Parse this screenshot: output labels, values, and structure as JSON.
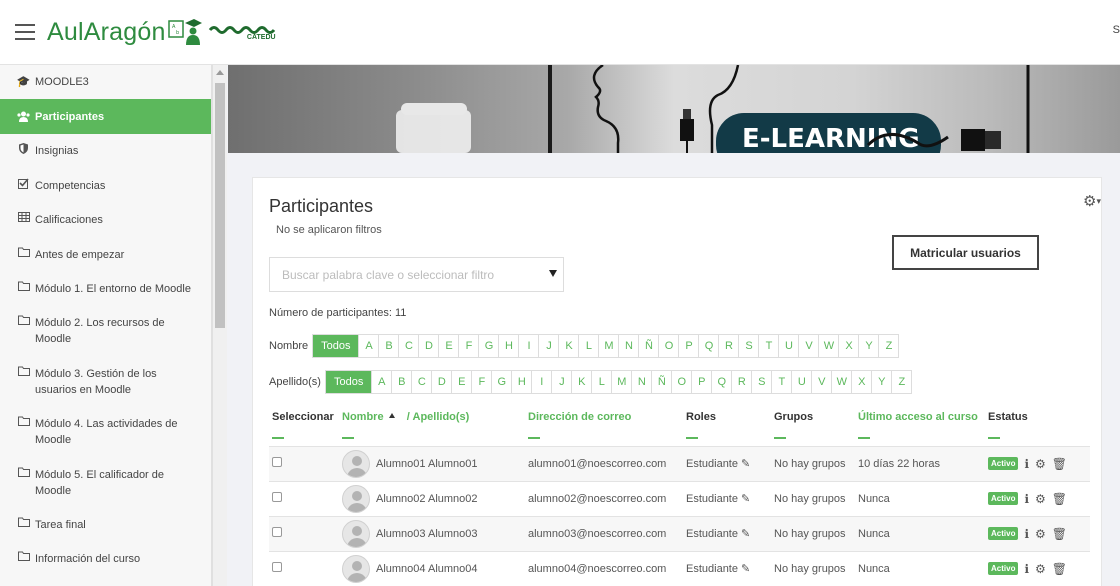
{
  "header": {
    "logo_text": "AulAragón",
    "partner_label": "CATEDU",
    "user_initial": "S"
  },
  "sidebar": {
    "items": [
      {
        "label": "MOODLE3",
        "icon": "graduation-cap-icon"
      },
      {
        "label": "Participantes",
        "icon": "users-icon",
        "active": true
      },
      {
        "label": "Insignias",
        "icon": "shield-icon"
      },
      {
        "label": "Competencias",
        "icon": "checkbox-icon"
      },
      {
        "label": "Calificaciones",
        "icon": "table-icon"
      },
      {
        "label": "Antes de empezar",
        "icon": "folder-icon"
      },
      {
        "label": "Módulo 1. El entorno de Moodle",
        "icon": "folder-icon"
      },
      {
        "label": "Módulo 2. Los recursos de Moodle",
        "icon": "folder-icon"
      },
      {
        "label": "Módulo 3. Gestión de los usuarios en Moodle",
        "icon": "folder-icon"
      },
      {
        "label": "Módulo 4. Las actividades de Moodle",
        "icon": "folder-icon"
      },
      {
        "label": "Módulo 5. El calificador de Moodle",
        "icon": "folder-icon"
      },
      {
        "label": "Tarea final",
        "icon": "folder-icon"
      },
      {
        "label": "Información del curso",
        "icon": "folder-icon"
      }
    ]
  },
  "banner": {
    "text": "E-LEARNING"
  },
  "main": {
    "title": "Participantes",
    "filter_status": "No se aplicaron filtros",
    "enrol_button": "Matricular usuarios",
    "search_placeholder": "Buscar palabra clave o seleccionar filtro",
    "participant_count": "Número de participantes: 11",
    "firstname_label": "Nombre",
    "lastname_label": "Apellido(s)",
    "all_label": "Todos",
    "letters": [
      "A",
      "B",
      "C",
      "D",
      "E",
      "F",
      "G",
      "H",
      "I",
      "J",
      "K",
      "L",
      "M",
      "N",
      "Ñ",
      "O",
      "P",
      "Q",
      "R",
      "S",
      "T",
      "U",
      "V",
      "W",
      "X",
      "Y",
      "Z"
    ]
  },
  "table": {
    "headers": {
      "select": "Seleccionar",
      "firstname": "Nombre",
      "lastname": "/ Apellido(s)",
      "email": "Dirección de correo",
      "roles": "Roles",
      "groups": "Grupos",
      "last_access": "Último acceso al curso",
      "status": "Estatus"
    },
    "rows": [
      {
        "name": "Alumno01 Alumno01",
        "email": "alumno01@noescorreo.com",
        "role": "Estudiante",
        "groups": "No hay grupos",
        "last_access": "10 días 22 horas",
        "status": "Activo"
      },
      {
        "name": "Alumno02 Alumno02",
        "email": "alumno02@noescorreo.com",
        "role": "Estudiante",
        "groups": "No hay grupos",
        "last_access": "Nunca",
        "status": "Activo"
      },
      {
        "name": "Alumno03 Alumno03",
        "email": "alumno03@noescorreo.com",
        "role": "Estudiante",
        "groups": "No hay grupos",
        "last_access": "Nunca",
        "status": "Activo"
      },
      {
        "name": "Alumno04 Alumno04",
        "email": "alumno04@noescorreo.com",
        "role": "Estudiante",
        "groups": "No hay grupos",
        "last_access": "Nunca",
        "status": "Activo"
      }
    ]
  },
  "colors": {
    "accent": "#5cb85c",
    "brand": "#2e8b3f"
  }
}
